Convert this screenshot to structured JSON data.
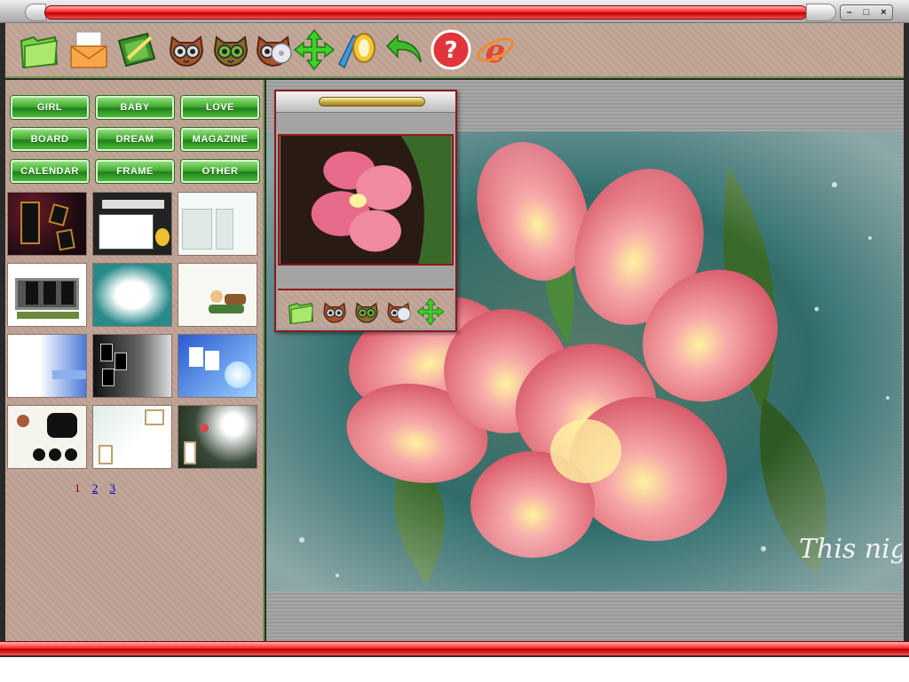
{
  "window": {
    "controls": {
      "minimize": "–",
      "maximize": "□",
      "close": "×"
    }
  },
  "toolbar": {
    "tools": [
      {
        "name": "open-folder-icon",
        "tooltip": ""
      },
      {
        "name": "save-envelope-icon",
        "tooltip": ""
      },
      {
        "name": "edit-photo-icon",
        "tooltip": ""
      },
      {
        "name": "owl-brown-icon",
        "tooltip": ""
      },
      {
        "name": "owl-green-icon",
        "tooltip": ""
      },
      {
        "name": "owl-cd-icon",
        "tooltip": ""
      },
      {
        "name": "move-arrows-icon",
        "tooltip": ""
      },
      {
        "name": "zoom-tool-icon",
        "tooltip": ""
      },
      {
        "name": "undo-arrow-icon",
        "tooltip": ""
      },
      {
        "name": "help-icon",
        "tooltip": ""
      },
      {
        "name": "internet-explorer-icon",
        "tooltip": ""
      }
    ]
  },
  "categories": [
    "GIRL",
    "BABY",
    "LOVE",
    "BOARD",
    "DREAM",
    "MAGAZINE",
    "CALENDAR",
    "FRAME",
    "OTHER"
  ],
  "thumbnails": [
    {
      "name": "thumb-dark-red-frames"
    },
    {
      "name": "thumb-board-white"
    },
    {
      "name": "thumb-white-panels"
    },
    {
      "name": "thumb-window-panes"
    },
    {
      "name": "thumb-teal-oval"
    },
    {
      "name": "thumb-cartoon-kids"
    },
    {
      "name": "thumb-blue-fade"
    },
    {
      "name": "thumb-black-filmstrip"
    },
    {
      "name": "thumb-blue-frames"
    },
    {
      "name": "thumb-circles-white"
    },
    {
      "name": "thumb-green-fade"
    },
    {
      "name": "thumb-floral-dark"
    }
  ],
  "pager": {
    "current": "1",
    "pages": [
      "2",
      "3"
    ]
  },
  "canvas": {
    "caption": "This night"
  },
  "preview": {
    "tools": [
      "open-folder-icon",
      "owl-brown-icon",
      "owl-green-icon",
      "owl-cd-icon",
      "move-arrows-icon"
    ]
  },
  "colors": {
    "accent_green": "#3aa52a",
    "title_red": "#ff2a2a",
    "panel_tan": "#c0a598"
  }
}
